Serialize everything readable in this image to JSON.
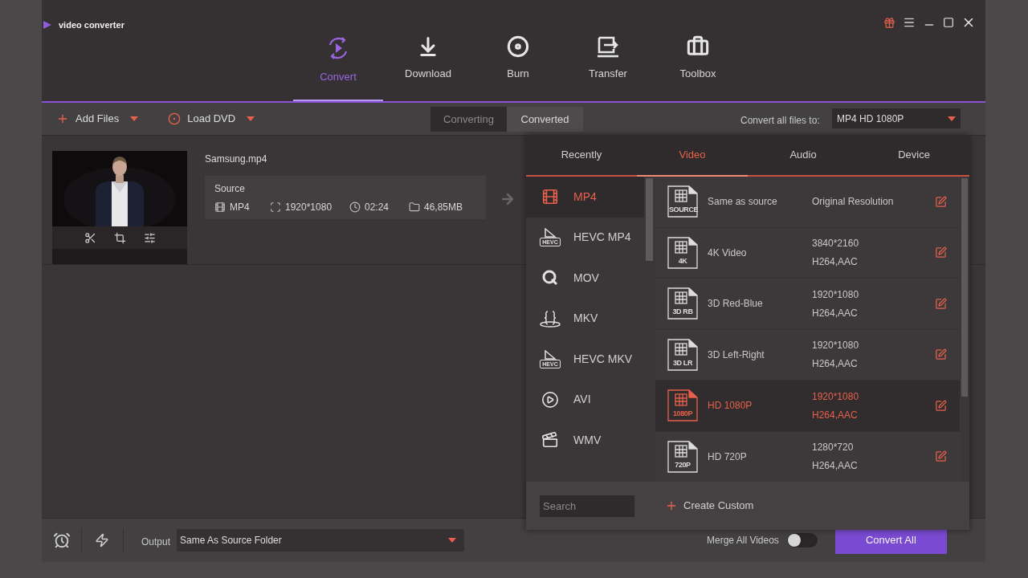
{
  "app": {
    "title": "video converter"
  },
  "nav": [
    {
      "label": "Convert",
      "kind": "convert",
      "selected": true
    },
    {
      "label": "Download",
      "kind": "download",
      "selected": false
    },
    {
      "label": "Burn",
      "kind": "burn",
      "selected": false
    },
    {
      "label": "Transfer",
      "kind": "transfer",
      "selected": false
    },
    {
      "label": "Toolbox",
      "kind": "toolbox",
      "selected": false
    }
  ],
  "toolbar": {
    "add_files": "Add Files",
    "load_dvd": "Load DVD",
    "status_tabs": [
      {
        "label": "Converting",
        "selected": false
      },
      {
        "label": "Converted",
        "selected": true
      }
    ],
    "convert_all_label": "Convert all files to:",
    "convert_all_value": "MP4 HD 1080P"
  },
  "file": {
    "name": "Samsung.mp4",
    "source_label": "Source",
    "format": "MP4",
    "resolution": "1920*1080",
    "duration": "02:24",
    "size": "46,85MB"
  },
  "format_popup": {
    "tabs": [
      {
        "label": "Recently",
        "selected": false
      },
      {
        "label": "Video",
        "selected": true
      },
      {
        "label": "Audio",
        "selected": false
      },
      {
        "label": "Device",
        "selected": false
      }
    ],
    "formats": [
      {
        "label": "MP4",
        "kind": "film",
        "selected": true
      },
      {
        "label": "HEVC MP4",
        "kind": "hevc",
        "badge": "HEVC",
        "selected": false
      },
      {
        "label": "MOV",
        "kind": "quicktime",
        "selected": false
      },
      {
        "label": "MKV",
        "kind": "braces",
        "selected": false
      },
      {
        "label": "HEVC MKV",
        "kind": "hevc",
        "badge": "HEVC",
        "selected": false
      },
      {
        "label": "AVI",
        "kind": "play",
        "selected": false
      },
      {
        "label": "WMV",
        "kind": "clapper",
        "selected": false
      }
    ],
    "presets": [
      {
        "badge": "SOURCE",
        "name": "Same as source",
        "detail": [
          "Original Resolution"
        ],
        "selected": false
      },
      {
        "badge": "4K",
        "name": "4K Video",
        "detail": [
          "3840*2160",
          "H264,AAC"
        ],
        "selected": false
      },
      {
        "badge": "3D RB",
        "name": "3D Red-Blue",
        "detail": [
          "1920*1080",
          "H264,AAC"
        ],
        "selected": false
      },
      {
        "badge": "3D LR",
        "name": "3D Left-Right",
        "detail": [
          "1920*1080",
          "H264,AAC"
        ],
        "selected": false
      },
      {
        "badge": "1080P",
        "name": "HD 1080P",
        "detail": [
          "1920*1080",
          "H264,AAC"
        ],
        "selected": true
      },
      {
        "badge": "720P",
        "name": "HD 720P",
        "detail": [
          "1280*720",
          "H264,AAC"
        ],
        "selected": false
      }
    ],
    "search": {
      "placeholder": "Search"
    },
    "create_custom": "Create Custom"
  },
  "bottom": {
    "output_label": "Output",
    "output_value": "Same As Source Folder",
    "merge_label": "Merge All Videos",
    "merge_on": false,
    "convert_all": "Convert All"
  }
}
